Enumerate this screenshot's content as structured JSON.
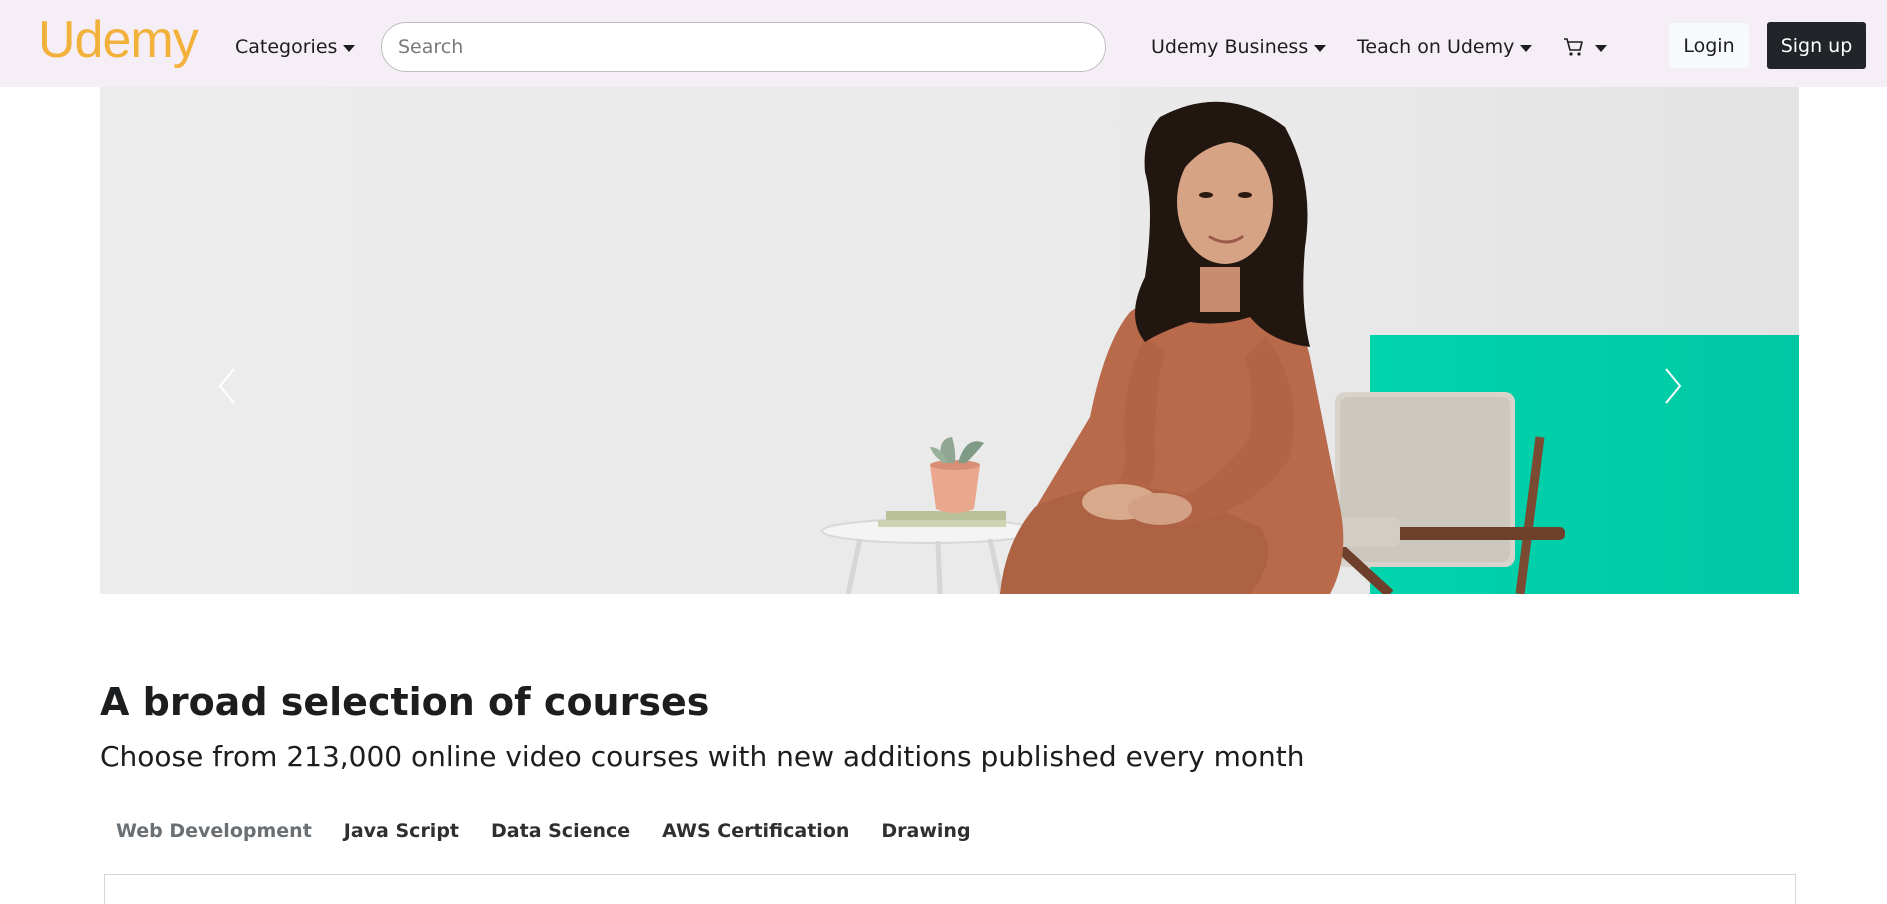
{
  "navbar": {
    "logo": "Udemy",
    "categories_label": "Categories",
    "search_placeholder": "Search",
    "business_label": "Udemy Business",
    "teach_label": "Teach on Udemy",
    "cart_icon": "cart-icon",
    "login_label": "Login",
    "signup_label": "Sign up",
    "logo_color": "#f2b13a",
    "background": "#f6eef6"
  },
  "hero": {
    "prev_icon": "chevron-left-icon",
    "next_icon": "chevron-right-icon",
    "accent_color": "#00d1a9"
  },
  "courses": {
    "title": "A broad selection of courses",
    "subtitle": "Choose from 213,000 online video courses with new additions published every month",
    "tabs": [
      {
        "label": "Web Development",
        "active": true
      },
      {
        "label": "Java Script",
        "active": false
      },
      {
        "label": "Data Science",
        "active": false
      },
      {
        "label": "AWS Certification",
        "active": false
      },
      {
        "label": "Drawing",
        "active": false
      }
    ]
  }
}
